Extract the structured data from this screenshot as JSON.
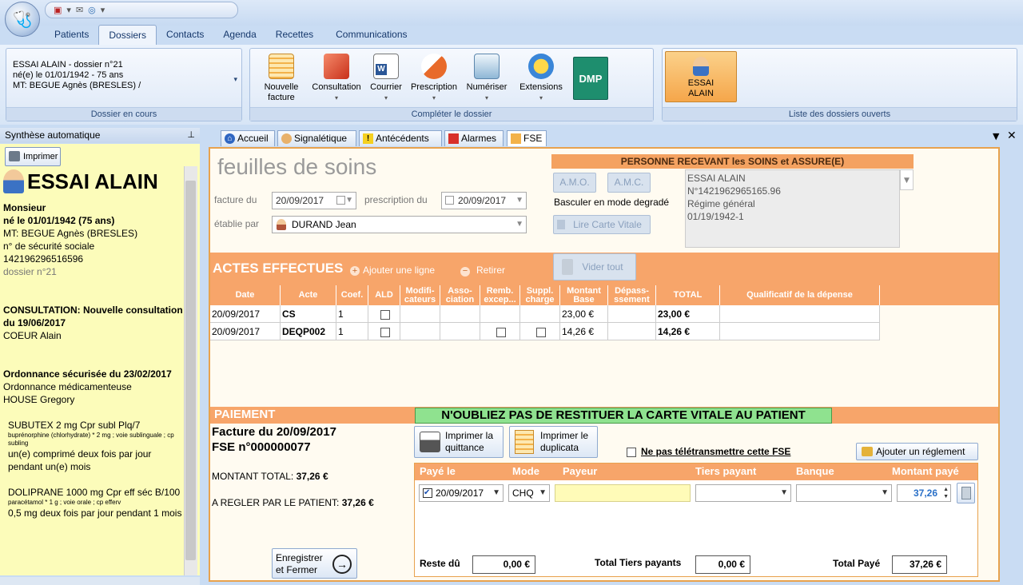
{
  "quick_access": {
    "pdf": "▣",
    "mail": "✉",
    "web": "◎"
  },
  "ribbon_tabs": [
    "Patients",
    "Dossiers",
    "Contacts",
    "Agenda",
    "Recettes",
    "Communications"
  ],
  "ribbon": {
    "dossier_en_cours": {
      "line1": "ESSAI ALAIN - dossier n°21",
      "line2": "né(e) le 01/01/1942 - 75 ans",
      "line3": "MT: BEGUE Agnès (BRESLES) /",
      "label": "Dossier en cours"
    },
    "completer": {
      "label": "Compléter le dossier",
      "buttons": [
        {
          "l1": "Nouvelle",
          "l2": "facture"
        },
        {
          "l1": "Consultation",
          "l2": ""
        },
        {
          "l1": "Courrier",
          "l2": ""
        },
        {
          "l1": "Prescription",
          "l2": ""
        },
        {
          "l1": "Numériser",
          "l2": ""
        },
        {
          "l1": "Extensions",
          "l2": ""
        },
        {
          "l1": "",
          "l2": ""
        }
      ],
      "dmp": "DMP"
    },
    "dossiers_ouverts": {
      "label": "Liste des dossiers ouverts",
      "btn_l1": "ESSAI",
      "btn_l2": "ALAIN"
    }
  },
  "left": {
    "header": "Synthèse automatique",
    "print": "Imprimer",
    "name": "ESSAI ALAIN",
    "civilite": "Monsieur",
    "birth": "né le 01/01/1942 (75 ans)",
    "mt": "MT: BEGUE Agnès (BRESLES)",
    "secu_label": "n° de sécurité sociale",
    "secu": "142196296516596",
    "dossier": "dossier n°21",
    "consult_title": "CONSULTATION: Nouvelle consultation du 19/06/2017",
    "consult_doc": "COEUR Alain",
    "ordo_title": "Ordonnance sécurisée du 23/02/2017",
    "ordo_type": "Ordonnance médicamenteuse",
    "ordo_doc": "HOUSE Gregory",
    "med1": "SUBUTEX 2 mg Cpr subl Plq/7",
    "med1_detail": "buprénorphine (chlorhydrate) * 2 mg ; voie sublinguale ; cp subling",
    "med1_poso": "un(e) comprimé deux fois par jour pendant  un(e) mois",
    "med2": "DOLIPRANE 1000 mg Cpr eff séc B/100",
    "med2_detail": "paracétamol * 1 g ; voie orale ; cp efferv",
    "med2_poso": "0,5 mg deux fois par jour pendant 1 mois"
  },
  "doc_tabs": [
    "Accueil",
    "Signalétique",
    "Antécédents",
    "Alarmes",
    "FSE"
  ],
  "fse": {
    "title": "feuilles de soins",
    "facture_du_label": "facture du",
    "facture_du": "20/09/2017",
    "prescription_du_label": "prescription du",
    "prescription_du": "20/09/2017",
    "etablie_label": "établie par",
    "etablie": "DURAND Jean",
    "amo": "A.M.O.",
    "amc": "A.M.C.",
    "degrade": "Basculer en mode degradé",
    "lire_carte": "Lire Carte Vitale",
    "assure_head": "PERSONNE RECEVANT les SOINS et ASSURE(E)",
    "assure": [
      "ESSAI ALAIN",
      "N°1421962965165.96",
      "Régime général",
      "01/19/1942-1"
    ],
    "vider": "Vider tout",
    "actes_title": "ACTES EFFECTUES",
    "ajouter": "Ajouter une ligne",
    "retirer": "Retirer",
    "columns": [
      "Date",
      "Acte",
      "Coef.",
      "ALD",
      "Modifi-cateurs",
      "Asso-ciation",
      "Remb. excep...",
      "Suppl. charge",
      "Montant Base",
      "Dépass-ssement",
      "TOTAL",
      "Qualificatif de la dépense"
    ],
    "rows": [
      {
        "date": "20/09/2017",
        "acte": "CS",
        "coef": "1",
        "base": "23,00 €",
        "total": "23,00 €"
      },
      {
        "date": "20/09/2017",
        "acte": "DEQP002",
        "coef": "1",
        "base": "14,26 €",
        "total": "14,26 €"
      }
    ],
    "paiement": "PAIEMENT",
    "warning": "N'OUBLIEZ PAS DE RESTITUER LA CARTE VITALE AU PATIENT",
    "facture_line": "Facture du 20/09/2017",
    "fse_line": "FSE n°000000077",
    "montant_total_label": "MONTANT TOTAL:",
    "montant_total": "37,26 €",
    "a_regler_label": "A REGLER PAR LE PATIENT:",
    "a_regler": "37,26 €",
    "imprimer_quittance_l1": "Imprimer la",
    "imprimer_quittance_l2": "quittance",
    "imprimer_duplicata_l1": "Imprimer le",
    "imprimer_duplicata_l2": "duplicata",
    "no_teletrans": "Ne pas télétransmettre cette FSE",
    "ajouter_reglement": "Ajouter un réglement",
    "pay_cols": [
      "Payé le",
      "Mode",
      "Payeur",
      "Tiers payant",
      "Banque",
      "Montant payé"
    ],
    "pay_row": {
      "date": "20/09/2017",
      "mode": "CHQ",
      "payeur": "",
      "tiers": "",
      "banque": "",
      "montant": "37,26"
    },
    "reste_du_label": "Reste dû",
    "reste_du": "0,00 €",
    "total_tiers_label": "Total Tiers payants",
    "total_tiers": "0,00 €",
    "total_paye_label": "Total Payé",
    "total_paye": "37,26 €",
    "enregistrer_l1": "Enregistrer",
    "enregistrer_l2": "et Fermer"
  }
}
